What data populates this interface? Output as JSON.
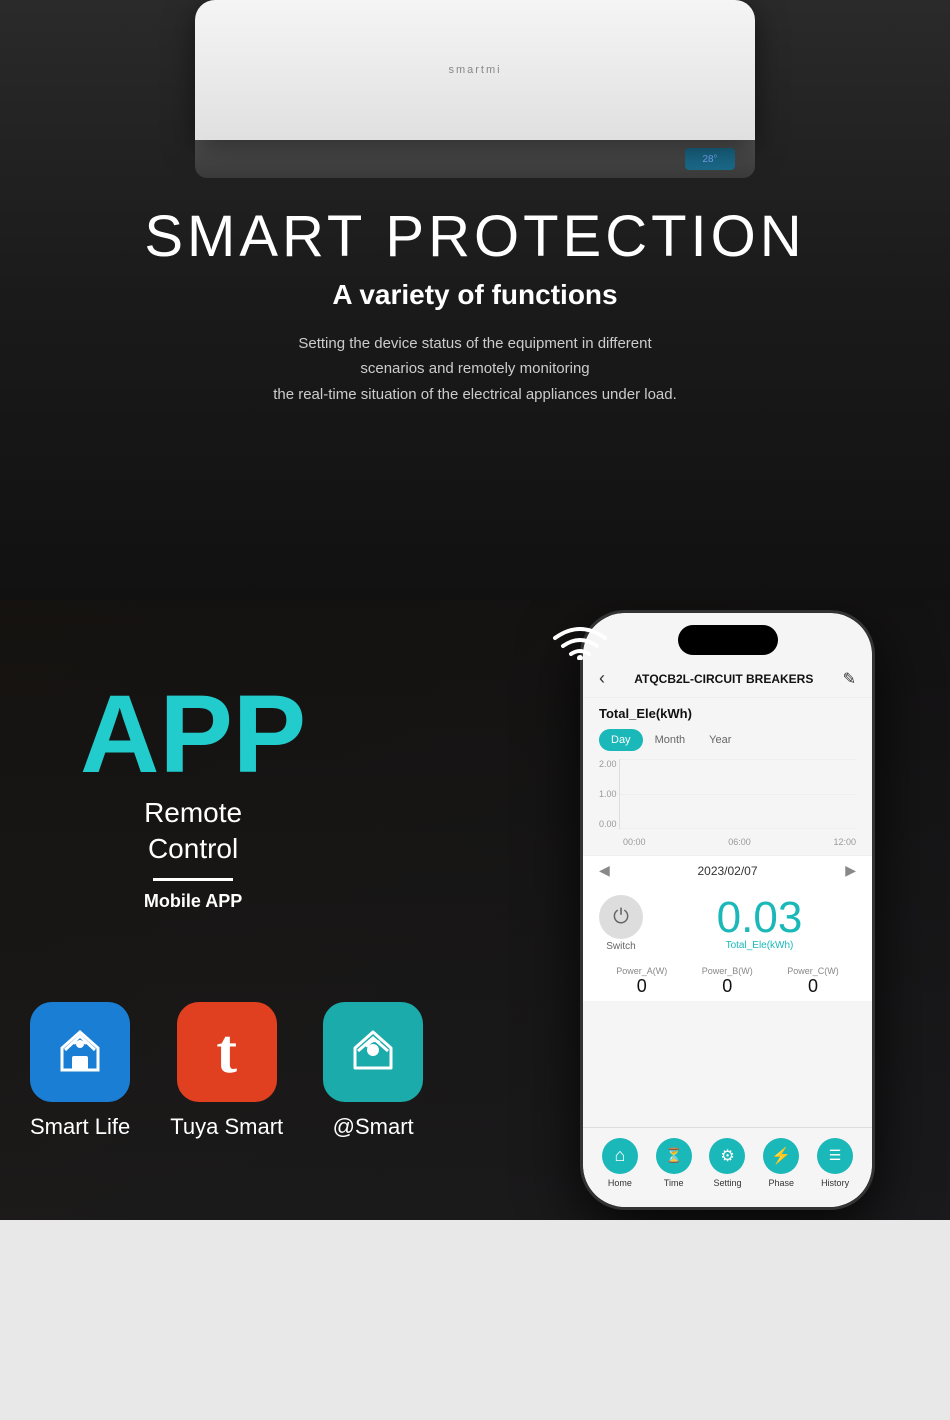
{
  "page": {
    "background_color": "#1a1a1a"
  },
  "ac_unit": {
    "brand": "smartmi"
  },
  "hero": {
    "main_title": "SMART PROTECTION",
    "sub_title": "A variety of functions",
    "description": "Setting the device status of the equipment in different\nscenarios and remotely monitoring\nthe real-time situation of the electrical appliances under load."
  },
  "app_section": {
    "app_label": "APP",
    "remote_label": "Remote\nControl",
    "mobile_label": "Mobile APP"
  },
  "app_icons": [
    {
      "id": "smart-life",
      "label": "Smart Life",
      "color": "#1a7fd4",
      "icon": "🏠"
    },
    {
      "id": "tuya-smart",
      "label": "Tuya Smart",
      "color": "#e04020",
      "icon": "t"
    },
    {
      "id": "at-smart",
      "label": "@Smart",
      "color": "#1aabaa",
      "icon": "🏠"
    }
  ],
  "phone": {
    "header_title": "ATQCB2L-CIRCUIT BREAKERS",
    "energy_label": "Total_Ele(kWh)",
    "tabs": [
      "Day",
      "Month",
      "Year"
    ],
    "active_tab": "Day",
    "chart": {
      "y_labels": [
        "2.00",
        "1.00",
        "0.00"
      ],
      "x_labels": [
        "00:00",
        "06:00",
        "12:00"
      ]
    },
    "date": "2023/02/07",
    "switch_label": "Switch",
    "energy_value": "0.03",
    "energy_unit_label": "Total_Ele(kWh)",
    "power_items": [
      {
        "label": "Power_A(W)",
        "value": "0"
      },
      {
        "label": "Power_B(W)",
        "value": "0"
      },
      {
        "label": "Power_C(W)",
        "value": "0"
      }
    ],
    "nav_items": [
      {
        "label": "Home",
        "icon": "⌂"
      },
      {
        "label": "Time",
        "icon": "⏳"
      },
      {
        "label": "Setting",
        "icon": "⚙"
      },
      {
        "label": "Phase",
        "icon": "⚡"
      },
      {
        "label": "History",
        "icon": "☰"
      }
    ]
  },
  "bottom": {
    "bg_color": "#e8e8e8"
  }
}
